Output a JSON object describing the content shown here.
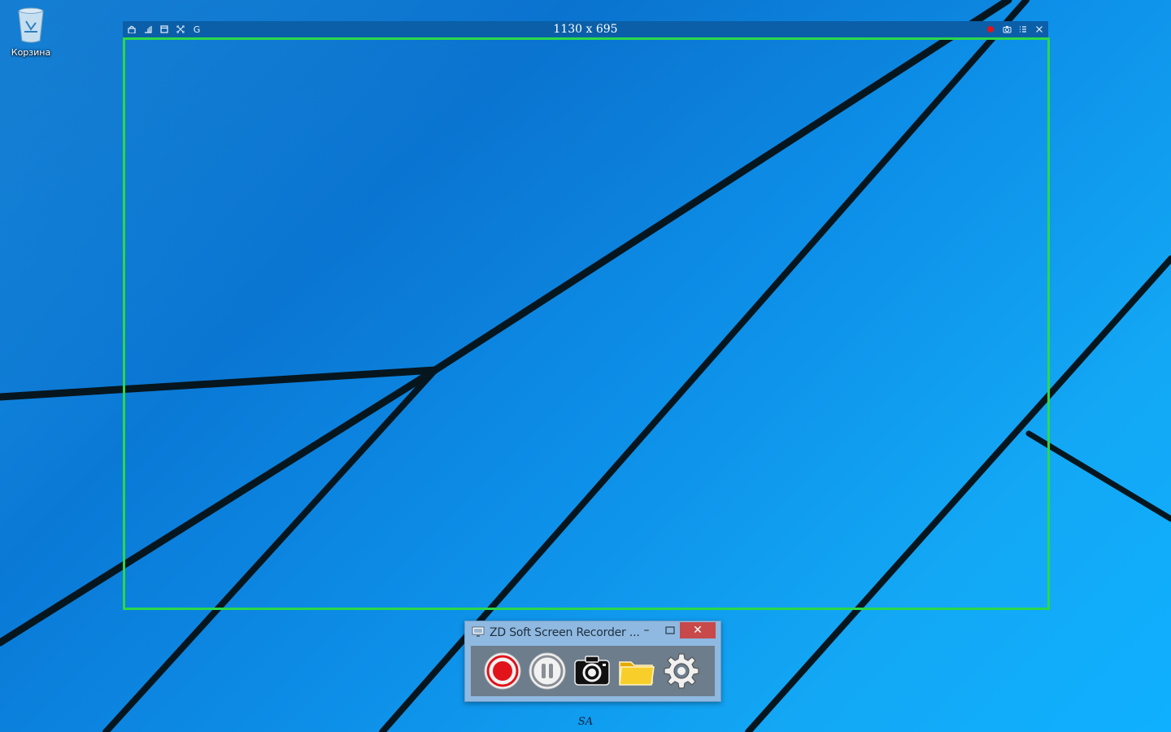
{
  "desktop": {
    "recycle_bin_label": "Корзина"
  },
  "capture_region": {
    "dimensions_label": "1130 x 695",
    "left_tools": [
      {
        "icon": "lock-icon"
      },
      {
        "icon": "align-bottom-right-icon"
      },
      {
        "icon": "window-icon"
      },
      {
        "icon": "fullscreen-icon"
      },
      {
        "icon": "g-letter-icon",
        "text": "G"
      }
    ],
    "right_tools": [
      {
        "icon": "record-dot-icon"
      },
      {
        "icon": "camera-icon"
      },
      {
        "icon": "list-menu-icon"
      },
      {
        "icon": "close-icon"
      }
    ],
    "frame_color": "#2bd84a",
    "bar_color": "#0a5fa8"
  },
  "recorder_window": {
    "title": "ZD Soft Screen Recorder ...",
    "minimize_label": "–",
    "close_label": "✕",
    "buttons": [
      {
        "name": "record",
        "icon": "record-icon",
        "color": "#e0141a"
      },
      {
        "name": "pause",
        "icon": "pause-icon"
      },
      {
        "name": "screenshot",
        "icon": "camera-icon"
      },
      {
        "name": "open-folder",
        "icon": "folder-icon",
        "color": "#f5c518"
      },
      {
        "name": "settings",
        "icon": "gear-icon"
      }
    ]
  },
  "taskbar_hint": {
    "label": "SA"
  }
}
